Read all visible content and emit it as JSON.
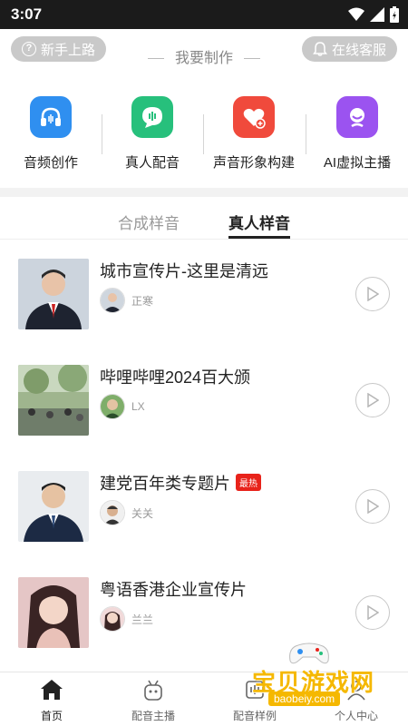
{
  "status": {
    "time": "3:07"
  },
  "top": {
    "guide_label": "新手上路",
    "title": "我要制作",
    "service_label": "在线客服"
  },
  "features": [
    {
      "label": "音频创作",
      "icon": "headphones-icon",
      "color": "#2f8ff0"
    },
    {
      "label": "真人配音",
      "icon": "chat-voice-icon",
      "color": "#27c07c"
    },
    {
      "label": "声音形象构建",
      "icon": "heart-voice-icon",
      "color": "#f04a3c"
    },
    {
      "label": "AI虚拟主播",
      "icon": "virtual-anchor-icon",
      "color": "#9b53f0"
    }
  ],
  "tabs": [
    {
      "label": "合成样音",
      "active": false
    },
    {
      "label": "真人样音",
      "active": true
    }
  ],
  "items": [
    {
      "title": "城市宣传片-这里是清远",
      "author": "正寒",
      "badge": ""
    },
    {
      "title": "哔哩哔哩2024百大颁",
      "author": "LX",
      "badge": ""
    },
    {
      "title": "建党百年类专题片",
      "author": "关关",
      "badge": "最热"
    },
    {
      "title": "粤语香港企业宣传片",
      "author": "兰兰",
      "badge": ""
    }
  ],
  "nav": [
    {
      "label": "首页",
      "icon": "home-icon",
      "active": true
    },
    {
      "label": "配音主播",
      "icon": "anchor-icon",
      "active": false
    },
    {
      "label": "配音样例",
      "icon": "samples-icon",
      "active": false
    },
    {
      "label": "个人中心",
      "icon": "profile-icon",
      "active": false
    }
  ],
  "watermark": {
    "text": "宝贝游戏网",
    "url": "baobeiy.com"
  },
  "colors": {
    "accent": "#222222",
    "hot_badge": "#e8231b",
    "watermark": "#f5b800"
  }
}
